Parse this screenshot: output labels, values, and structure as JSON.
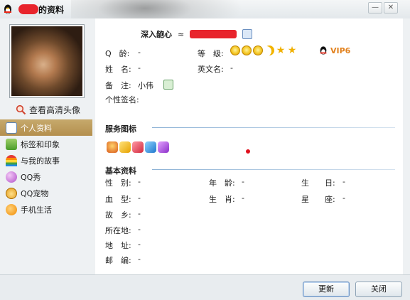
{
  "window": {
    "title": "的资料",
    "minimize_label": "—",
    "close_label": "✕"
  },
  "left": {
    "view_hd_label": "查看高清头像",
    "nav": [
      {
        "label": "个人资料",
        "icon": "id-card-icon",
        "active": true
      },
      {
        "label": "标签和印象",
        "icon": "tag-icon",
        "active": false
      },
      {
        "label": "与我的故事",
        "icon": "rainbow-icon",
        "active": false
      },
      {
        "label": "QQ秀",
        "icon": "qq-show-icon",
        "active": false
      },
      {
        "label": "QQ宠物",
        "icon": "pet-icon",
        "active": false
      },
      {
        "label": "手机生活",
        "icon": "phone-check-icon",
        "active": false
      }
    ]
  },
  "profile": {
    "nickname": "深入龅心",
    "approx": "≈",
    "qq_label": "Q　龄:",
    "qq_value": "-",
    "level_label": "等　级:",
    "vip_text": "VIP6",
    "name_label": "姓　名:",
    "name_value": "-",
    "english_label": "英文名:",
    "english_value": "-",
    "remark_label": "备　注:",
    "remark_value": "小伟",
    "signature_label": "个性签名:"
  },
  "service": {
    "title": "服务图标"
  },
  "basic": {
    "title": "基本资料",
    "rows": [
      {
        "l1": "性　别:",
        "v1": "-",
        "l2": "年　龄:",
        "v2": "-",
        "l3": "生　　日:",
        "v3": "-"
      },
      {
        "l1": "血　型:",
        "v1": "-",
        "l2": "生　肖:",
        "v2": "-",
        "l3": "星　　座:",
        "v3": "-"
      },
      {
        "l1": "故　乡:",
        "v1": "-"
      },
      {
        "l1": "所在地:",
        "v1": "-"
      },
      {
        "l1": "地　址:",
        "v1": "-"
      },
      {
        "l1": "邮　编:",
        "v1": "-"
      }
    ]
  },
  "buttons": {
    "update": "更新",
    "close": "关闭"
  }
}
